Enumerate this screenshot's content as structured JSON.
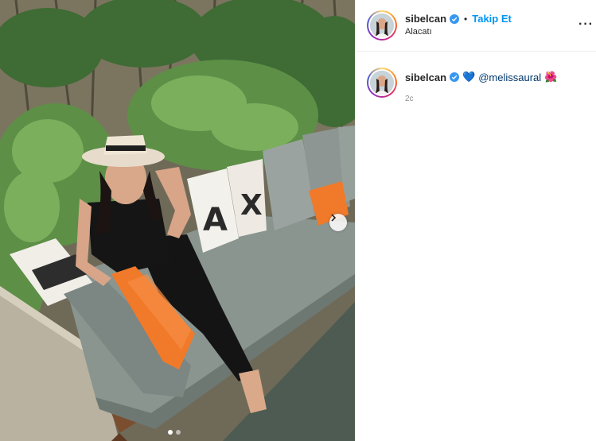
{
  "post": {
    "author": {
      "username": "sibelcan",
      "verified": true,
      "follow_label": "Takip Et",
      "separator": "•",
      "location": "Alacatı"
    },
    "more_label": "···",
    "caption": {
      "username": "sibelcan",
      "emoji_heart": "💙",
      "mention": "@melissaural",
      "emoji_flower": "🌺",
      "time": "2c"
    },
    "media": {
      "carousel_count": 2,
      "active_index": 0
    }
  },
  "colors": {
    "follow": "#0095f6",
    "mention": "#00376b",
    "verified": "#3897f0",
    "cushion_orange": "#f07a2a",
    "cushion_grey": "#8a9590"
  }
}
